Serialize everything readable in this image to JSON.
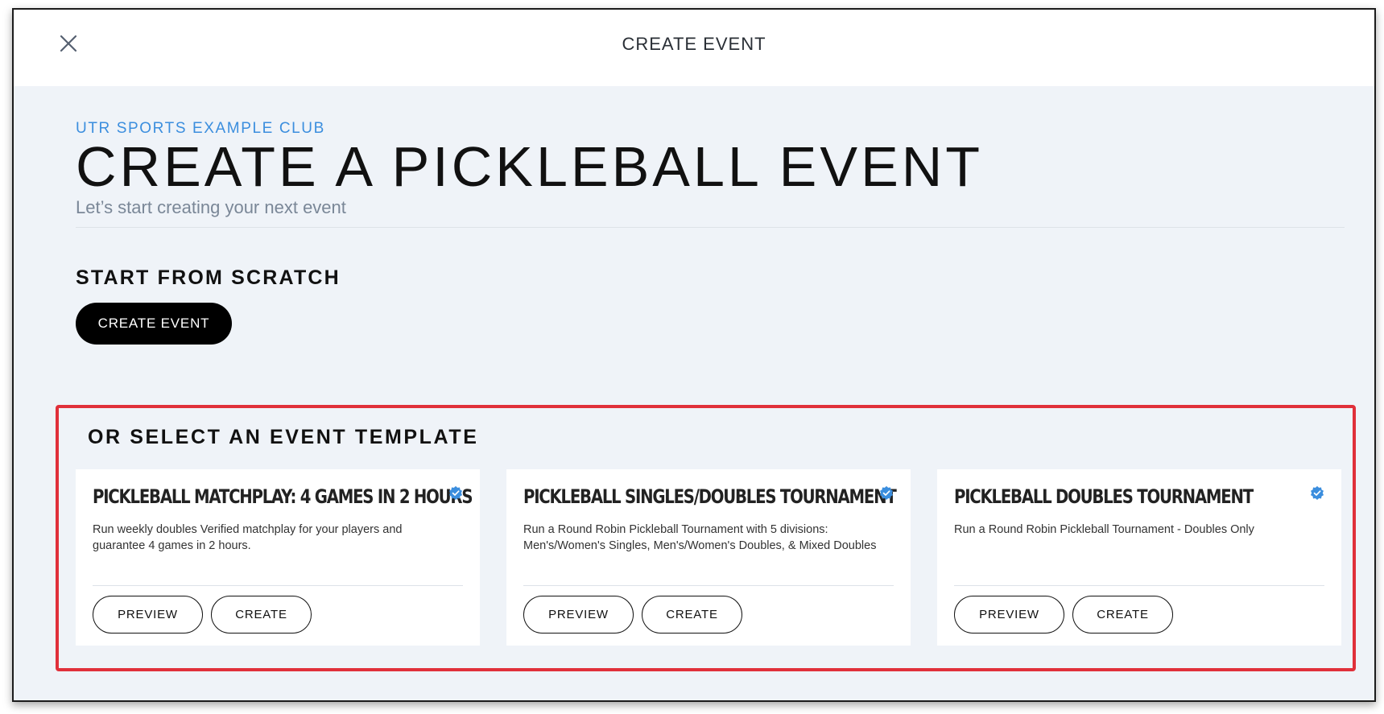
{
  "topbar": {
    "title": "CREATE EVENT"
  },
  "header": {
    "club_name": "UTR SPORTS EXAMPLE CLUB",
    "title": "CREATE A PICKLEBALL EVENT",
    "subtitle": "Let’s start creating your next event"
  },
  "scratch": {
    "heading": "START FROM SCRATCH",
    "button_label": "CREATE EVENT"
  },
  "templates": {
    "heading": "OR SELECT AN EVENT TEMPLATE",
    "cards": [
      {
        "title": "PICKLEBALL MATCHPLAY: 4 GAMES IN 2 HOURS",
        "description": "Run weekly doubles Verified matchplay for your players and guarantee 4 games in 2 hours.",
        "preview_label": "PREVIEW",
        "create_label": "CREATE"
      },
      {
        "title": "PICKLEBALL SINGLES/DOUBLES TOURNAMENT",
        "description": "Run a Round Robin Pickleball Tournament with 5 divisions: Men's/Women's Singles, Men's/Women's Doubles, & Mixed Doubles",
        "preview_label": "PREVIEW",
        "create_label": "CREATE"
      },
      {
        "title": "PICKLEBALL DOUBLES TOURNAMENT",
        "description": "Run a Round Robin Pickleball Tournament - Doubles Only",
        "preview_label": "PREVIEW",
        "create_label": "CREATE"
      }
    ]
  },
  "colors": {
    "accent": "#3b8ede",
    "highlight_border": "#e0303a",
    "background": "#eff3f8"
  },
  "icons": {
    "close": "close-icon",
    "verified": "verified-badge-icon"
  }
}
